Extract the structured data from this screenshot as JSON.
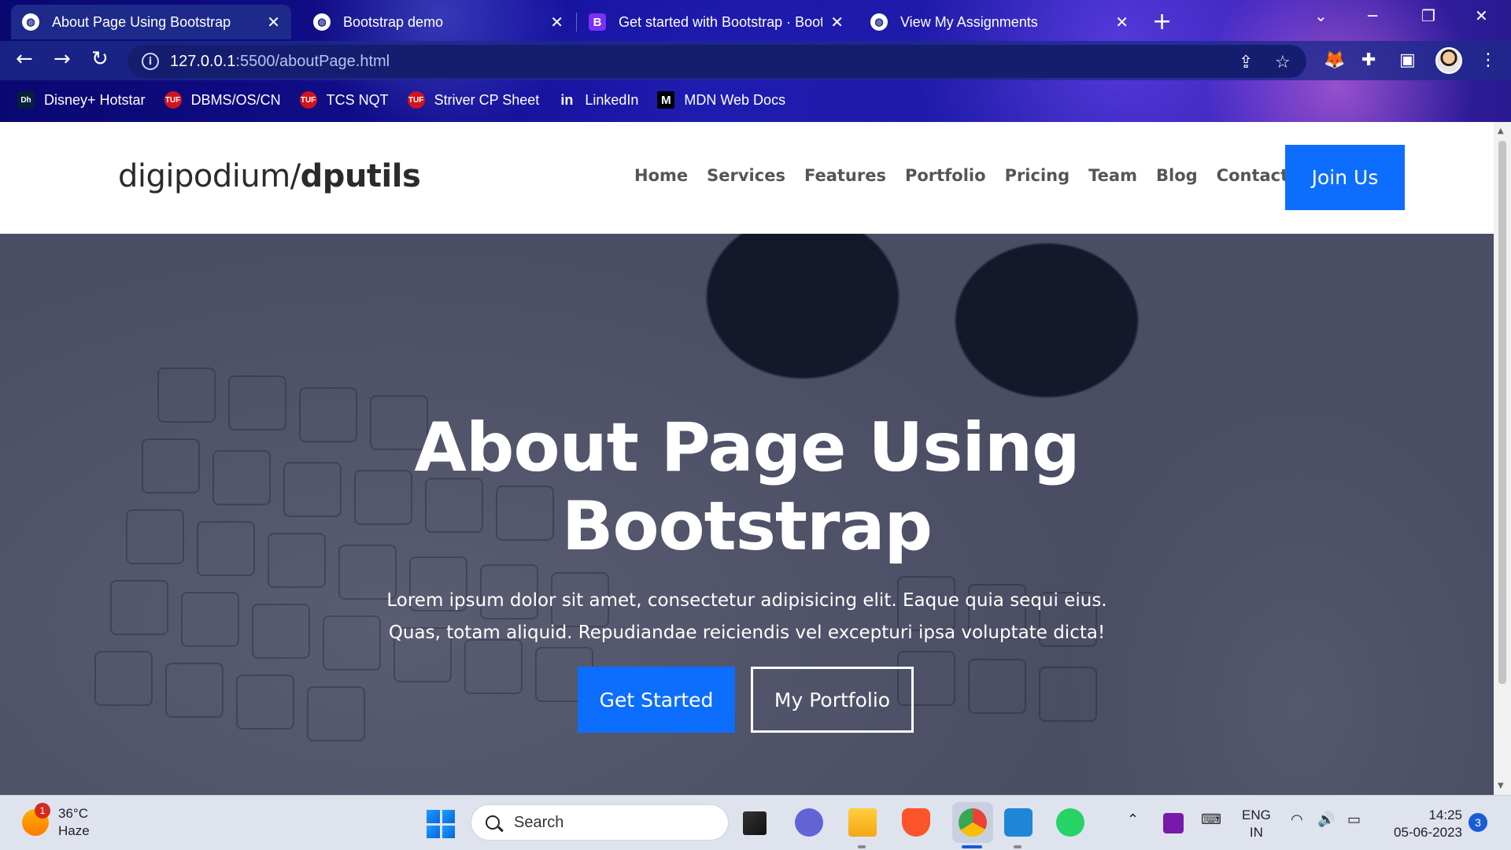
{
  "browser": {
    "tabs": [
      {
        "title": "About Page Using Bootstrap",
        "icon": "globe-icon",
        "active": true
      },
      {
        "title": "Bootstrap demo",
        "icon": "globe-icon",
        "active": false
      },
      {
        "title": "Get started with Bootstrap · Boot",
        "icon": "bootstrap-icon",
        "active": false
      },
      {
        "title": "View My Assignments",
        "icon": "globe-icon",
        "active": false
      }
    ],
    "url_host": "127.0.0.1",
    "url_rest": ":5500/aboutPage.html",
    "bookmarks": [
      {
        "label": "Disney+ Hotstar",
        "icon": "hotstar-icon"
      },
      {
        "label": "DBMS/OS/CN",
        "icon": "tuf-icon"
      },
      {
        "label": "TCS NQT",
        "icon": "tuf-icon"
      },
      {
        "label": "Striver CP Sheet",
        "icon": "tuf-icon"
      },
      {
        "label": "LinkedIn",
        "icon": "linkedin-icon"
      },
      {
        "label": "MDN Web Docs",
        "icon": "mdn-icon"
      }
    ]
  },
  "site": {
    "logo_prefix": "digipodium/",
    "logo_bold": "dputils",
    "nav": [
      "Home",
      "Services",
      "Features",
      "Portfolio",
      "Pricing",
      "Team",
      "Blog",
      "Contact"
    ],
    "join_label": "Join Us",
    "accent": "#0d6efd"
  },
  "hero": {
    "title_line1": "About Page Using",
    "title_line2": "Bootstrap",
    "text_line1": "Lorem ipsum dolor sit amet, consectetur adipisicing elit. Eaque quia sequi eius.",
    "text_line2": "Quas, totam aliquid. Repudiandae reiciendis vel excepturi ipsa voluptate dicta!",
    "primary_button": "Get Started",
    "secondary_button": "My Portfolio"
  },
  "taskbar": {
    "weather_temp": "36°C",
    "weather_desc": "Haze",
    "weather_badge": "1",
    "search_placeholder": "Search",
    "lang_line1": "ENG",
    "lang_line2": "IN",
    "time": "14:25",
    "date": "05-06-2023",
    "notifications": "3"
  }
}
